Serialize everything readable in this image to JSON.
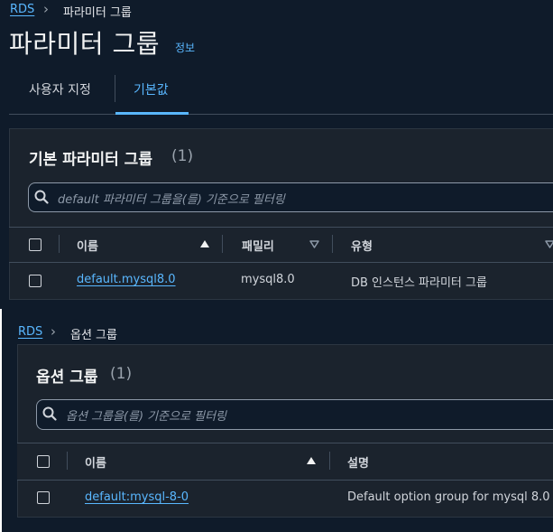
{
  "top": {
    "breadcrumb": {
      "root": "RDS",
      "current": "파라미터 그룹"
    },
    "title": "파라미터 그룹",
    "info": "정보",
    "tabs": [
      {
        "label": "사용자 지정",
        "active": false
      },
      {
        "label": "기본값",
        "active": true
      }
    ],
    "card": {
      "title": "기본 파라미터 그룹",
      "count": "(1)",
      "search_placeholder": "default 파라미터 그룹을(를) 기준으로 필터링",
      "columns": [
        "이름",
        "패밀리",
        "유형"
      ],
      "rows": [
        {
          "name": "default.mysql8.0",
          "family": "mysql8.0",
          "type": "DB 인스턴스 파라미터 그룹"
        }
      ]
    }
  },
  "bottom": {
    "breadcrumb": {
      "root": "RDS",
      "current": "옵션 그룹"
    },
    "card": {
      "title": "옵션 그룹",
      "count": "(1)",
      "search_placeholder": "옵션 그룹을(를) 기준으로 필터링",
      "columns": [
        "이름",
        "설명"
      ],
      "rows": [
        {
          "name": "default:mysql-8-0",
          "description": "Default option group for mysql 8.0"
        }
      ]
    }
  },
  "colors": {
    "background": "#0f1b2a",
    "card": "#1b232d",
    "accent": "#59b7ff",
    "text": "#d1d5db"
  },
  "icons": [
    "chevron-right-icon",
    "search-icon",
    "sort-ascending-icon",
    "sort-descending-icon"
  ]
}
